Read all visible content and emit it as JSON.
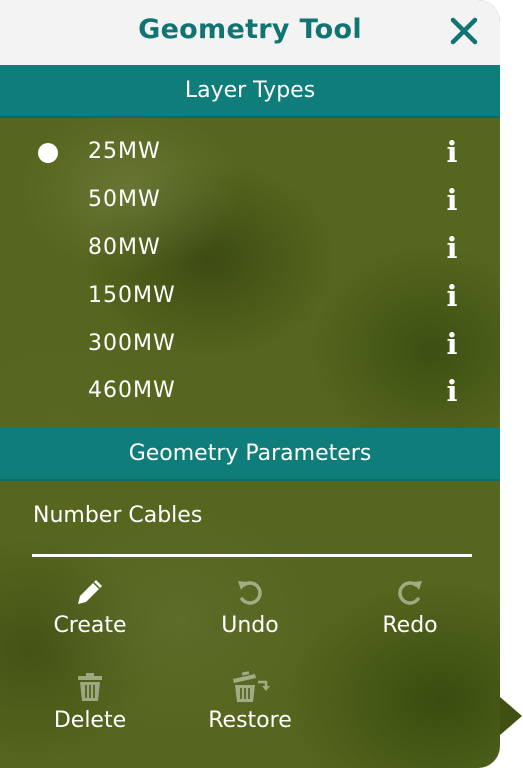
{
  "header": {
    "title": "Geometry Tool"
  },
  "layer_types": {
    "section_label": "Layer Types",
    "selected_index": 0,
    "items": [
      {
        "label": "25MW",
        "info": "i"
      },
      {
        "label": "50MW",
        "info": "i"
      },
      {
        "label": "80MW",
        "info": "i"
      },
      {
        "label": "150MW",
        "info": "i"
      },
      {
        "label": "300MW",
        "info": "i"
      },
      {
        "label": "460MW",
        "info": "i"
      }
    ]
  },
  "geometry_parameters": {
    "section_label": "Geometry Parameters",
    "number_cables": {
      "label": "Number Cables",
      "value": ""
    }
  },
  "actions": {
    "create": {
      "label": "Create",
      "icon": "pencil-icon"
    },
    "undo": {
      "label": "Undo",
      "icon": "undo-icon"
    },
    "redo": {
      "label": "Redo",
      "icon": "redo-icon"
    },
    "delete": {
      "label": "Delete",
      "icon": "trash-icon"
    },
    "restore": {
      "label": "Restore",
      "icon": "restore-trash-icon"
    }
  },
  "colors": {
    "accent": "#0f7d79",
    "title": "#107473",
    "panel_bg": "#55661e"
  }
}
